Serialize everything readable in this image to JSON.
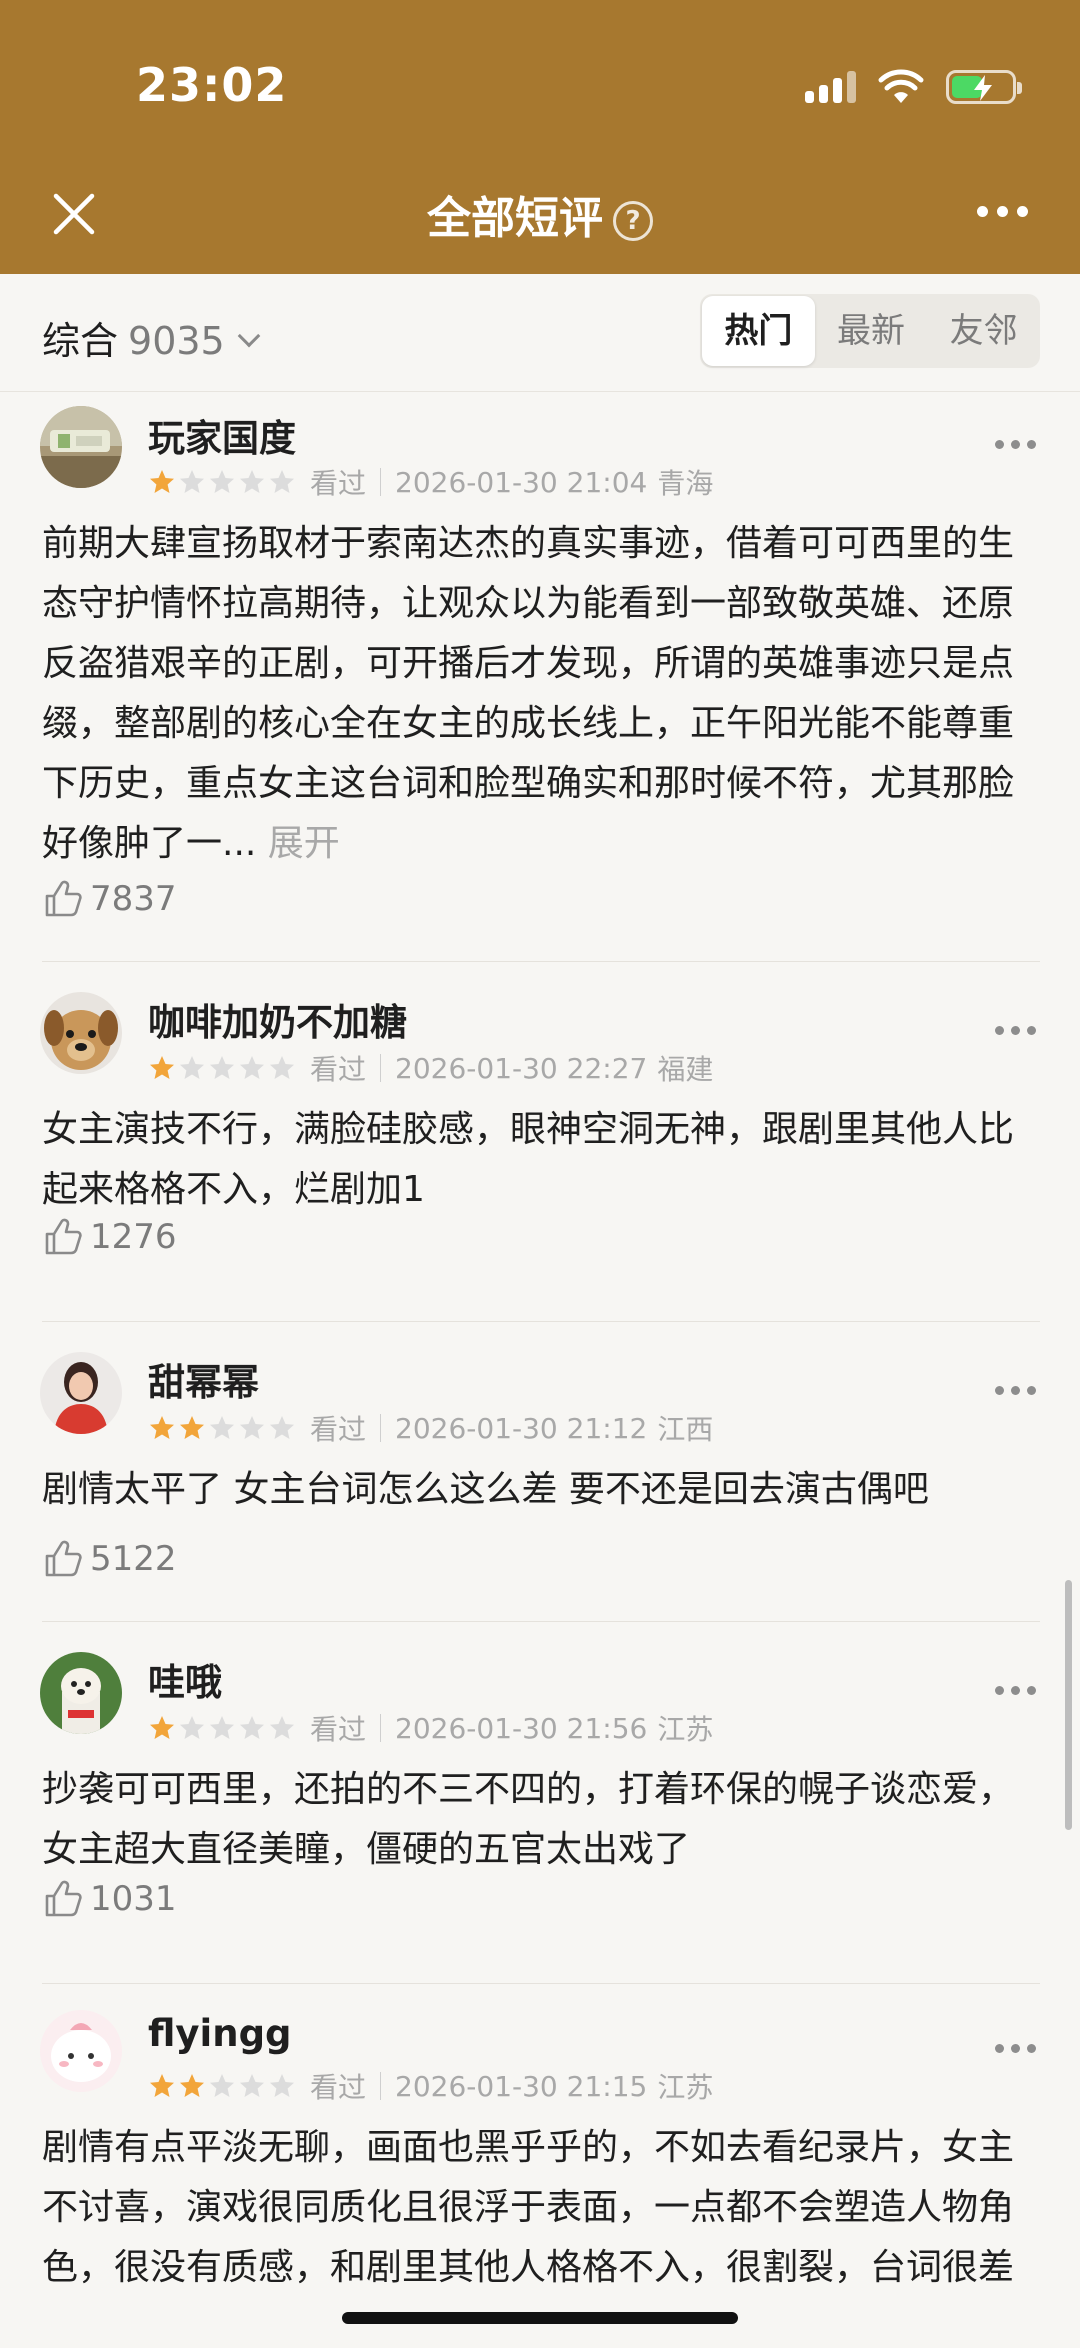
{
  "status_bar": {
    "time": "23:02"
  },
  "nav": {
    "title": "全部短评",
    "help_glyph": "?"
  },
  "filter": {
    "sort_label": "综合",
    "count": "9035",
    "tabs": [
      {
        "label": "热门",
        "active": true
      },
      {
        "label": "最新",
        "active": false
      },
      {
        "label": "友邻",
        "active": false
      }
    ]
  },
  "reviews": [
    {
      "username": "玩家国度",
      "rating": 1,
      "status": "看过",
      "datetime": "2026-01-30 21:04",
      "location": "青海",
      "text": "前期大肆宣扬取材于索南达杰的真实事迹，借着可可西里的生态守护情怀拉高期待，让观众以为能看到一部致敬英雄、还原反盗猎艰辛的正剧，可开播后才发现，所谓的英雄事迹只是点缀，整部剧的核心全在女主的成长线上，正午阳光能不能尊重下历史，重点女主这台词和脸型确实和那时候不符，尤其那脸好像肿了一...",
      "expand": "展开",
      "likes": "7837"
    },
    {
      "username": "咖啡加奶不加糖",
      "rating": 1,
      "status": "看过",
      "datetime": "2026-01-30 22:27",
      "location": "福建",
      "text": "女主演技不行，满脸硅胶感，眼神空洞无神，跟剧里其他人比起来格格不入，烂剧加1",
      "likes": "1276"
    },
    {
      "username": "甜幂幂",
      "rating": 2,
      "status": "看过",
      "datetime": "2026-01-30 21:12",
      "location": "江西",
      "text": "剧情太平了 女主台词怎么这么差 要不还是回去演古偶吧",
      "likes": "5122"
    },
    {
      "username": "哇哦",
      "rating": 1,
      "status": "看过",
      "datetime": "2026-01-30 21:56",
      "location": "江苏",
      "text": "抄袭可可西里，还拍的不三不四的，打着环保的幌子谈恋爱，女主超大直径美瞳，僵硬的五官太出戏了",
      "likes": "1031"
    },
    {
      "username": "flyingg",
      "rating": 2,
      "status": "看过",
      "datetime": "2026-01-30 21:15",
      "location": "江苏",
      "text": "剧情有点平淡无聊，画面也黑乎乎的，不如去看纪录片，女主不讨喜，演戏很同质化且很浮于表面，一点都不会塑造人物角色，很没有质感，和剧里其他人格格不入，很割裂，台词很差",
      "likes": ""
    }
  ],
  "colors": {
    "header_bg": "#a7782f",
    "page_bg": "#f7f6f3",
    "star_on": "#f2a53a",
    "star_off": "#dcdcdc",
    "muted_text": "#a8a8a8"
  }
}
